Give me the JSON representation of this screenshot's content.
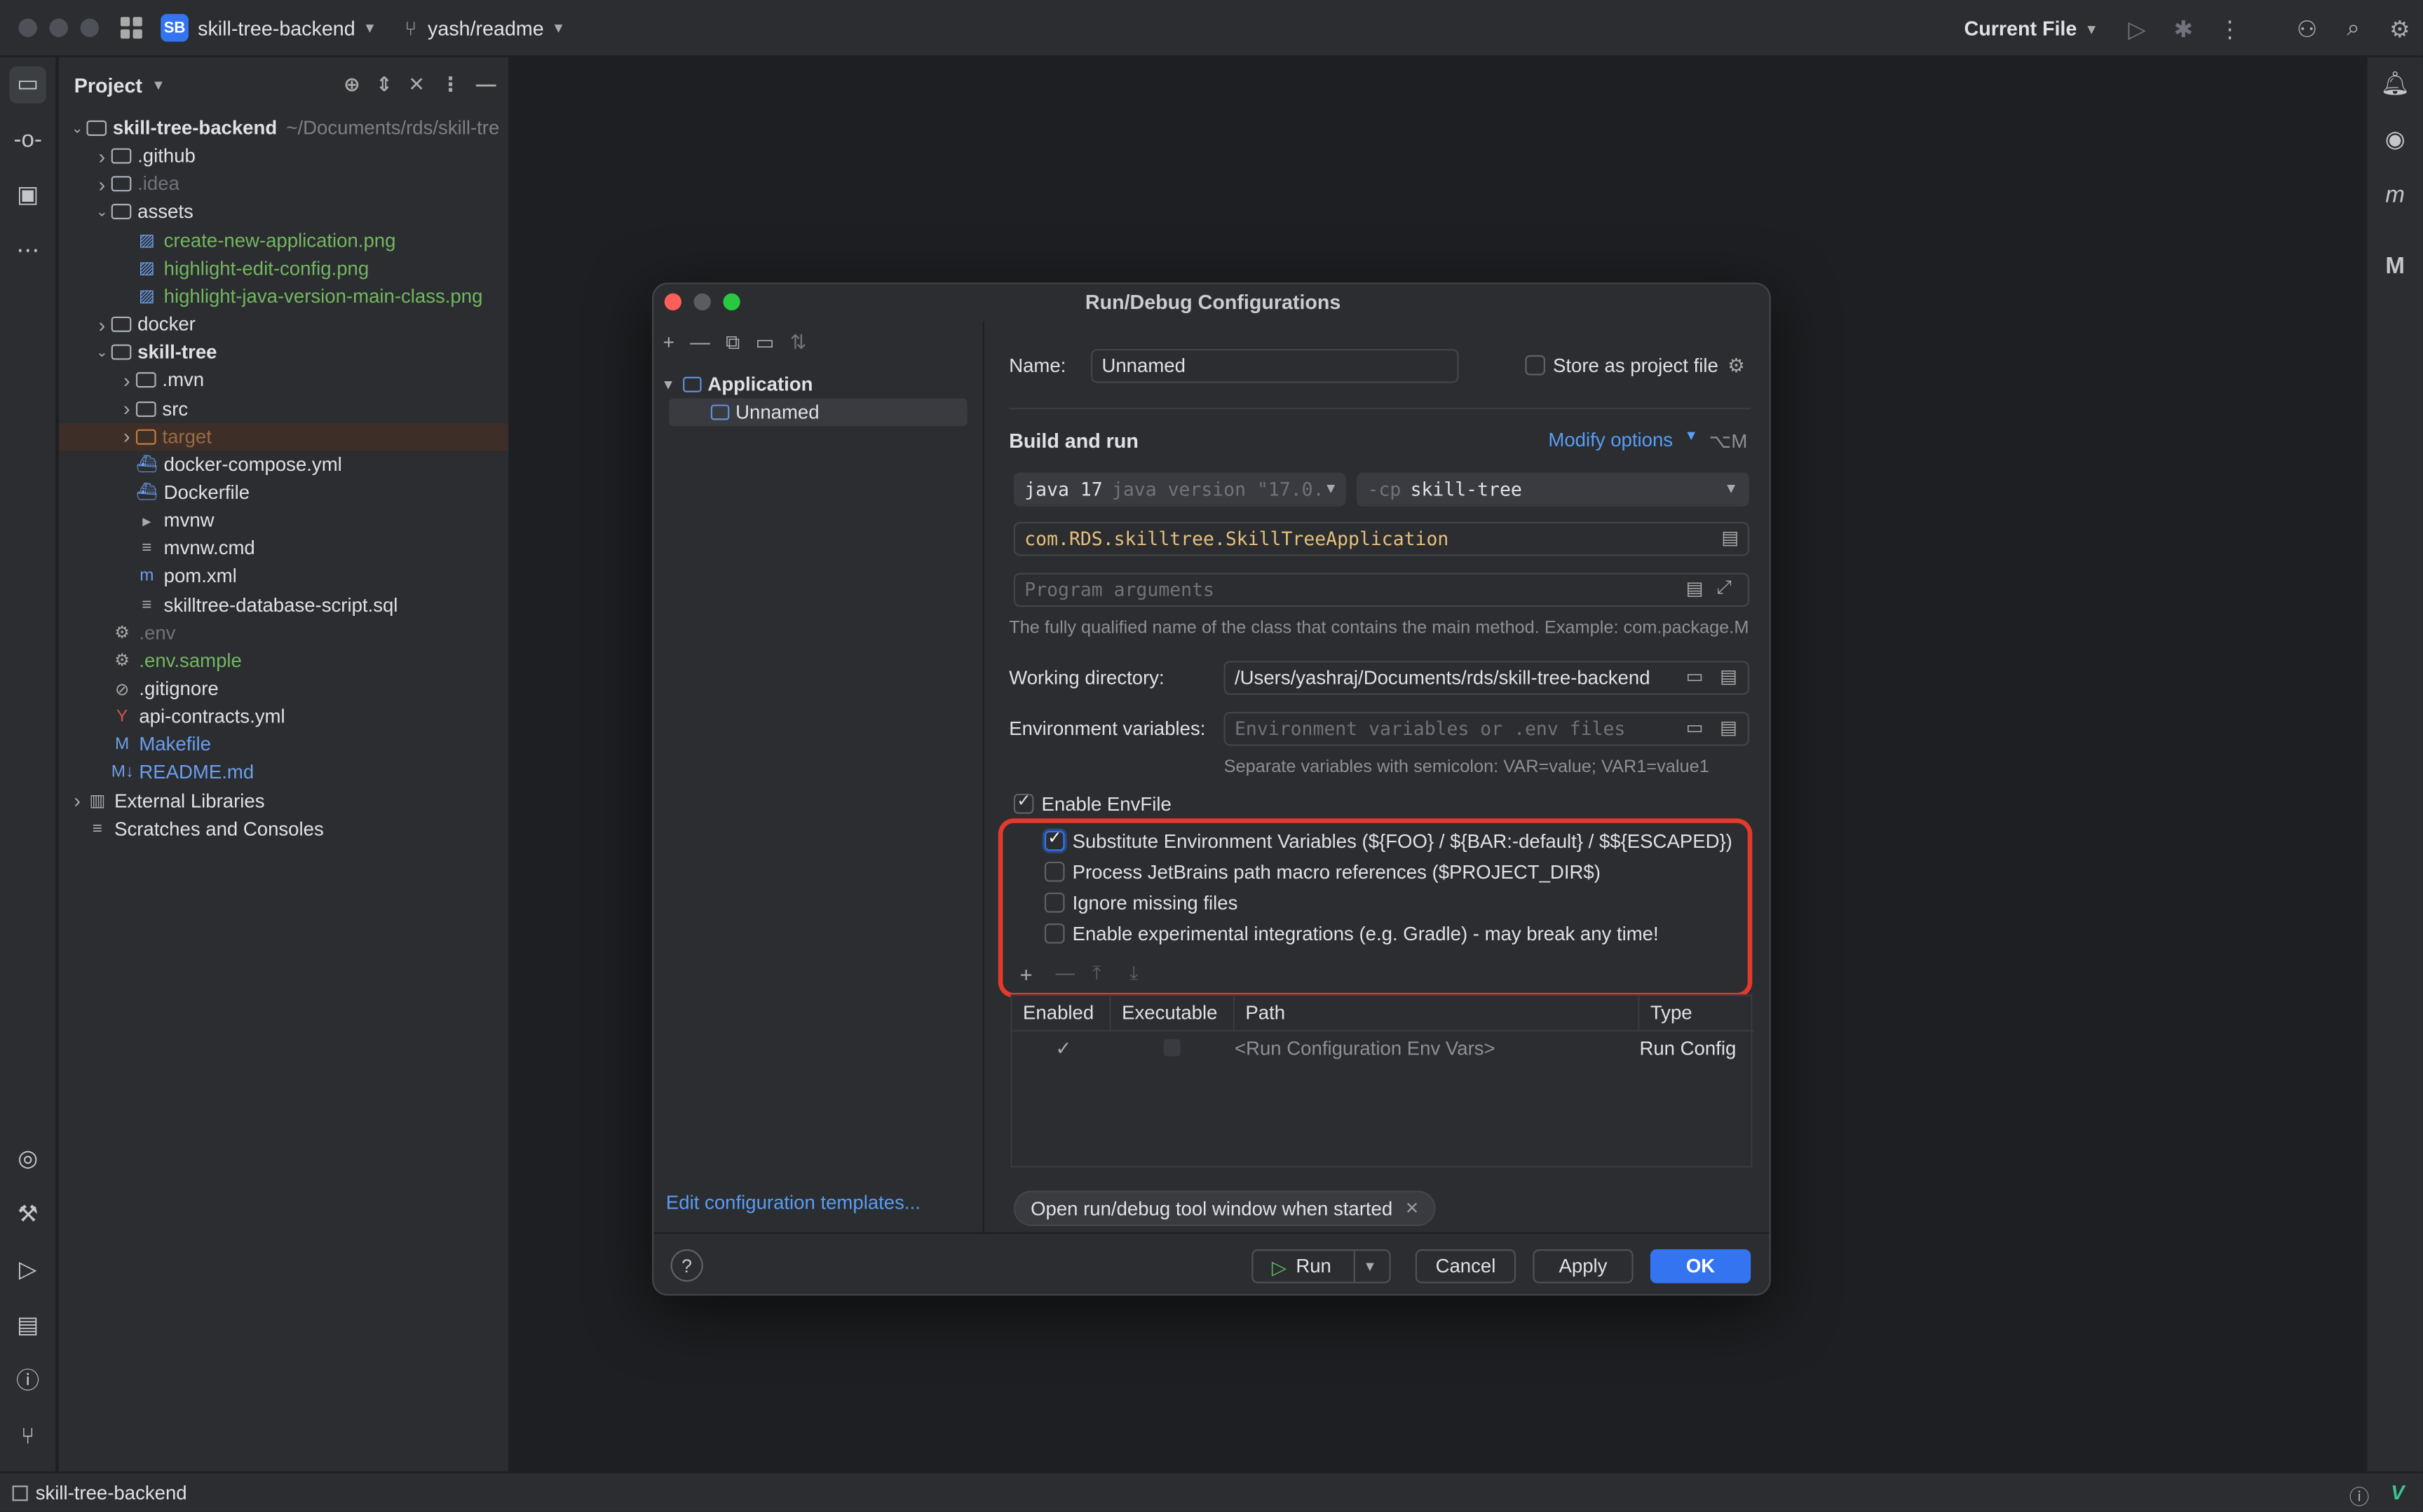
{
  "titlebar": {
    "project_badge": "SB",
    "project_name": "skill-tree-backend",
    "branch": "yash/readme",
    "run_config": "Current File"
  },
  "project_panel": {
    "title": "Project",
    "tree": [
      {
        "label": "skill-tree-backend",
        "path": "~/Documents/rds/skill-tre",
        "level": 0,
        "kind": "root",
        "open": true,
        "color": "normal",
        "bold": true
      },
      {
        "label": ".github",
        "level": 1,
        "kind": "folder",
        "open": false,
        "color": "normal"
      },
      {
        "label": ".idea",
        "level": 1,
        "kind": "folder",
        "open": false,
        "color": "grey"
      },
      {
        "label": "assets",
        "level": 1,
        "kind": "folder",
        "open": true,
        "color": "normal"
      },
      {
        "label": "create-new-application.png",
        "level": 2,
        "kind": "image",
        "color": "green"
      },
      {
        "label": "highlight-edit-config.png",
        "level": 2,
        "kind": "image",
        "color": "green"
      },
      {
        "label": "highlight-java-version-main-class.png",
        "level": 2,
        "kind": "image",
        "color": "green"
      },
      {
        "label": "docker",
        "level": 1,
        "kind": "folder",
        "open": false,
        "color": "normal"
      },
      {
        "label": "skill-tree",
        "level": 1,
        "kind": "module",
        "open": true,
        "color": "normal",
        "bold": true
      },
      {
        "label": ".mvn",
        "level": 2,
        "kind": "folder",
        "open": false,
        "color": "normal"
      },
      {
        "label": "src",
        "level": 2,
        "kind": "folder",
        "open": false,
        "color": "normal"
      },
      {
        "label": "target",
        "level": 2,
        "kind": "folder-orange",
        "open": false,
        "color": "orange",
        "selected": true
      },
      {
        "label": "docker-compose.yml",
        "level": 2,
        "kind": "docker",
        "color": "normal"
      },
      {
        "label": "Dockerfile",
        "level": 2,
        "kind": "docker",
        "color": "normal"
      },
      {
        "label": "mvnw",
        "level": 2,
        "kind": "terminal",
        "color": "normal"
      },
      {
        "label": "mvnw.cmd",
        "level": 2,
        "kind": "text",
        "color": "normal"
      },
      {
        "label": "pom.xml",
        "level": 2,
        "kind": "maven",
        "color": "normal"
      },
      {
        "label": "skilltree-database-script.sql",
        "level": 2,
        "kind": "text",
        "color": "normal"
      },
      {
        "label": ".env",
        "level": 1,
        "kind": "env",
        "color": "grey"
      },
      {
        "label": ".env.sample",
        "level": 1,
        "kind": "env",
        "color": "green"
      },
      {
        "label": ".gitignore",
        "level": 1,
        "kind": "ignore",
        "color": "normal"
      },
      {
        "label": "api-contracts.yml",
        "level": 1,
        "kind": "yaml",
        "color": "normal"
      },
      {
        "label": "Makefile",
        "level": 1,
        "kind": "makefile",
        "color": "blue"
      },
      {
        "label": "README.md",
        "level": 1,
        "kind": "markdown",
        "color": "blue"
      },
      {
        "label": "External Libraries",
        "level": 0,
        "kind": "library",
        "open": false,
        "color": "normal"
      },
      {
        "label": "Scratches and Consoles",
        "level": 0,
        "kind": "scratch",
        "color": "normal"
      }
    ]
  },
  "dialog": {
    "title": "Run/Debug Configurations",
    "tree": {
      "group": "Application",
      "item": "Unnamed"
    },
    "edit_templates": "Edit configuration templates...",
    "name_label": "Name:",
    "name_value": "Unnamed",
    "store_as_project_file": "Store as project file",
    "build_and_run": "Build and run",
    "modify_options": "Modify options",
    "modify_shortcut": "⌥M",
    "jdk": "java 17",
    "jdk_detail": "java version \"17.0.",
    "cp_prefix": "-cp",
    "cp_value": "skill-tree",
    "main_class": "com.RDS.skilltree.SkillTreeApplication",
    "program_args_placeholder": "Program arguments",
    "main_class_hint": "The fully qualified name of the class that contains the main method. Example: com.package.M",
    "working_dir_label": "Working directory:",
    "working_dir_value": "/Users/yashraj/Documents/rds/skill-tree-backend",
    "env_vars_label": "Environment variables:",
    "env_vars_placeholder": "Environment variables or .env files",
    "env_vars_hint": "Separate variables with semicolon: VAR=value; VAR1=value1",
    "envfile": {
      "enable": {
        "label": "Enable EnvFile",
        "checked": true
      },
      "options": [
        {
          "label": "Substitute Environment Variables (${FOO} / ${BAR:-default} / $${ESCAPED})",
          "checked": true
        },
        {
          "label": "Process JetBrains path macro references ($PROJECT_DIR$)",
          "checked": false
        },
        {
          "label": "Ignore missing files",
          "checked": false
        },
        {
          "label": "Enable experimental integrations (e.g. Gradle) - may break any time!",
          "checked": false
        }
      ]
    },
    "table": {
      "columns": [
        "Enabled",
        "Executable",
        "Path",
        "Type"
      ],
      "rows": [
        {
          "enabled": "✓",
          "executable": "",
          "path": "<Run Configuration Env Vars>",
          "type": "Run Config"
        }
      ]
    },
    "chip": "Open run/debug tool window when started",
    "buttons": {
      "help": "?",
      "run": "Run",
      "cancel": "Cancel",
      "apply": "Apply",
      "ok": "OK"
    }
  },
  "statusbar": {
    "project": "skill-tree-backend"
  },
  "colors": {
    "accent": "#3574f0",
    "highlight_box": "#e43a2c",
    "link": "#589df6"
  }
}
